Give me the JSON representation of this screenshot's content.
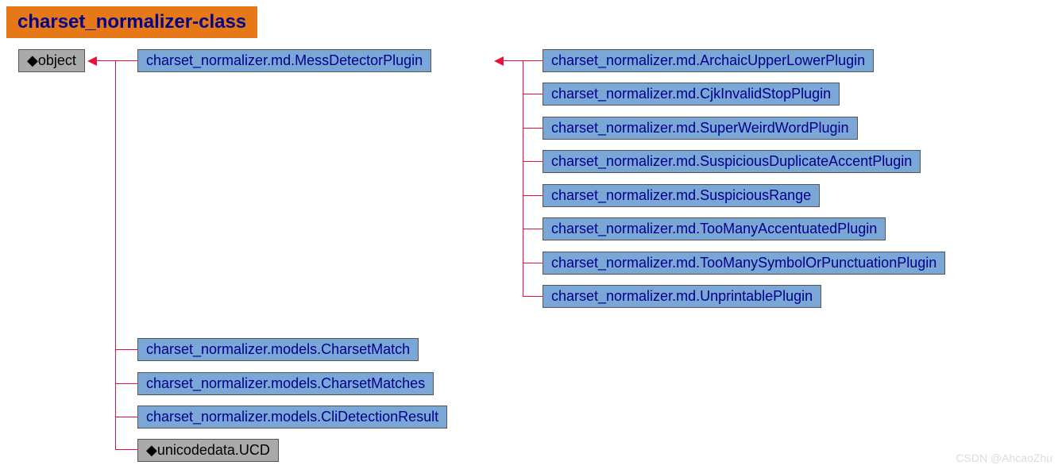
{
  "title": "charset_normalizer-class",
  "nodes": {
    "object": "◆object",
    "messDetector": "charset_normalizer.md.MessDetectorPlugin",
    "plugins": [
      "charset_normalizer.md.ArchaicUpperLowerPlugin",
      "charset_normalizer.md.CjkInvalidStopPlugin",
      "charset_normalizer.md.SuperWeirdWordPlugin",
      "charset_normalizer.md.SuspiciousDuplicateAccentPlugin",
      "charset_normalizer.md.SuspiciousRange",
      "charset_normalizer.md.TooManyAccentuatedPlugin",
      "charset_normalizer.md.TooManySymbolOrPunctuationPlugin",
      "charset_normalizer.md.UnprintablePlugin"
    ],
    "models": [
      "charset_normalizer.models.CharsetMatch",
      "charset_normalizer.models.CharsetMatches",
      "charset_normalizer.models.CliDetectionResult"
    ],
    "ucd": "◆unicodedata.UCD"
  },
  "watermark": "CSDN @AhcaoZhu"
}
